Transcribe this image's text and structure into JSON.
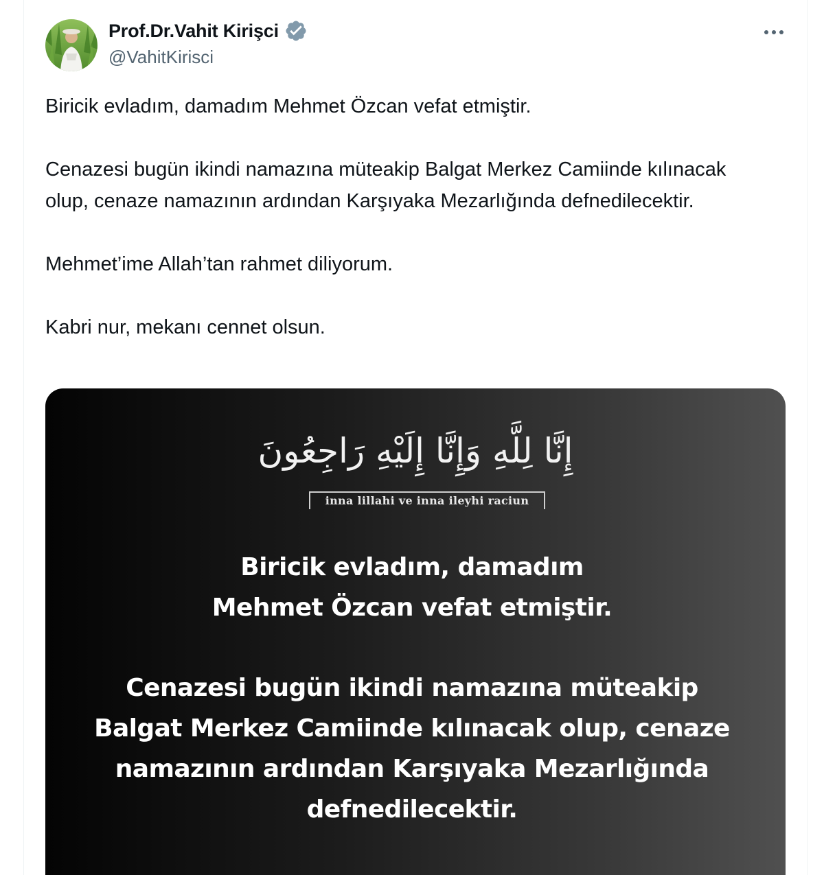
{
  "author": {
    "display_name": "Prof.Dr.Vahit Kirişci",
    "handle": "@VahitKirisci",
    "verified_icon": "verified-badge-icon",
    "verified_color": "#829aab"
  },
  "menu": {
    "more_icon": "more-dots-icon"
  },
  "tweet": {
    "paragraphs": [
      "Biricik evladım, damadım Mehmet Özcan vefat etmiştir.",
      "Cenazesi bugün ikindi namazına müteakip Balgat Merkez Camiinde kılınacak olup, cenaze namazının ardından Karşıyaka Mezarlığında defnedilecektir.",
      "Mehmet’ime Allah’tan rahmet diliyorum.",
      "Kabri nur, mekanı cennet olsun."
    ]
  },
  "image": {
    "arabic": "إِنَّا لِلَّهِ وَإِنَّا إِلَيْهِ رَاجِعُونَ",
    "transliteration": "inna lillahi ve inna ileyhi raciun",
    "lines": [
      "Biricik evladım, damadım",
      "Mehmet Özcan vefat etmiştir.",
      "Cenazesi bugün ikindi namazına müteakip",
      "Balgat Merkez Camiinde kılınacak olup, cenaze",
      "namazının ardından Karşıyaka Mezarlığında",
      "defnedilecektir."
    ]
  }
}
